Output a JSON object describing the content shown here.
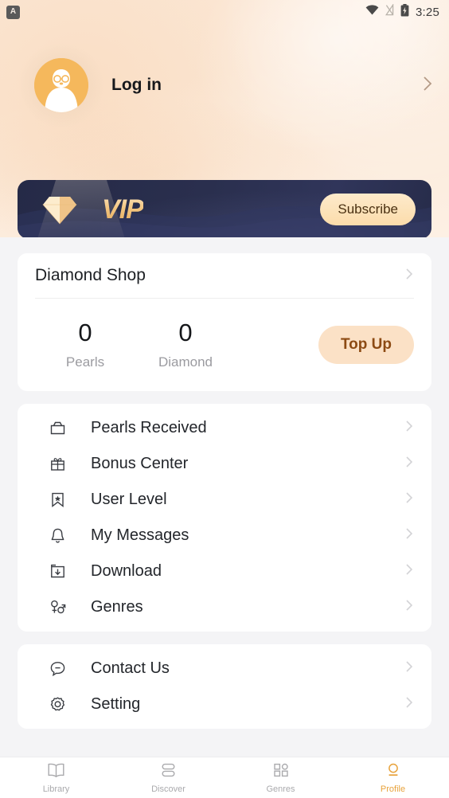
{
  "status_bar": {
    "app_icon_letter": "A",
    "time": "3:25",
    "icons": [
      "wifi-icon",
      "signal-off-icon",
      "battery-charging-icon"
    ]
  },
  "header": {
    "login_label": "Log in",
    "avatar_name": "user-avatar",
    "chevron": "›"
  },
  "vip_banner": {
    "logo_text": "VIP",
    "subscribe_label": "Subscribe",
    "gem_icon": "diamond-gem-icon",
    "bg_color": "#2a2f4e",
    "gold_color": "#f3c680"
  },
  "diamond_shop": {
    "title": "Diamond Shop",
    "chevron": "›",
    "stats": [
      {
        "value": "0",
        "label": "Pearls"
      },
      {
        "value": "0",
        "label": "Diamond"
      }
    ],
    "topup_label": "Top Up",
    "topup_bg": "#fbe1c6",
    "topup_color": "#8c4a13"
  },
  "menu_primary": [
    {
      "label": "Pearls Received",
      "icon": "wallet-icon"
    },
    {
      "label": "Bonus Center",
      "icon": "gift-icon"
    },
    {
      "label": "User Level",
      "icon": "bookmark-star-icon"
    },
    {
      "label": "My Messages",
      "icon": "bell-icon"
    },
    {
      "label": "Download",
      "icon": "download-folder-icon"
    },
    {
      "label": "Genres",
      "icon": "gender-symbols-icon"
    }
  ],
  "menu_secondary": [
    {
      "label": "Contact Us",
      "icon": "chat-bubble-icon"
    },
    {
      "label": "Setting",
      "icon": "gear-icon"
    }
  ],
  "bottom_nav": {
    "active_color": "#e8a33d",
    "tabs": [
      {
        "label": "Library",
        "icon": "book-icon",
        "active": false
      },
      {
        "label": "Discover",
        "icon": "discover-icon",
        "active": false
      },
      {
        "label": "Genres",
        "icon": "grid-icon",
        "active": false
      },
      {
        "label": "Profile",
        "icon": "profile-icon",
        "active": true
      }
    ]
  }
}
